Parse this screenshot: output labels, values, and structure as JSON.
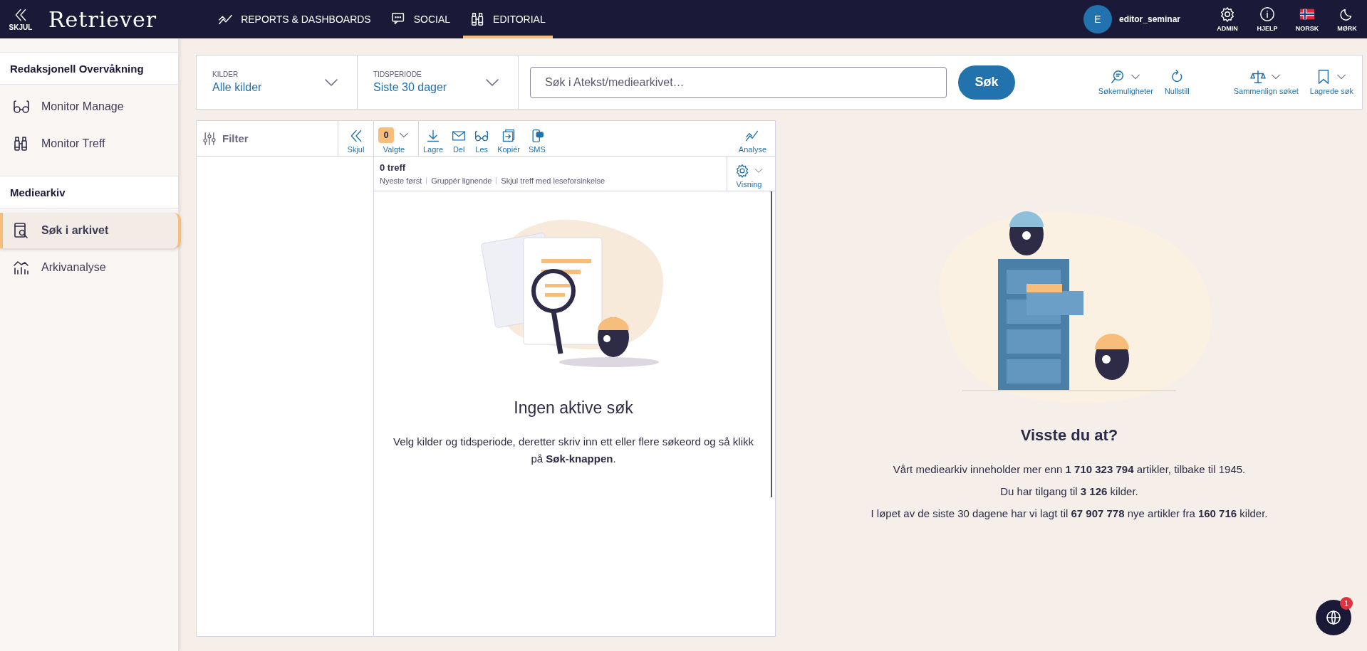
{
  "topbar": {
    "collapse": "SKJUL",
    "logo": "Retriever",
    "nav": [
      {
        "label": "REPORTS & DASHBOARDS",
        "kind": "chart",
        "selected": false
      },
      {
        "label": "SOCIAL",
        "kind": "chat",
        "selected": false
      },
      {
        "label": "EDITORIAL",
        "kind": "binoculars",
        "selected": true
      }
    ],
    "user": {
      "initial": "E",
      "name": "editor_seminar"
    },
    "actions": [
      {
        "label": "ADMIN",
        "kind": "gear"
      },
      {
        "label": "HJELP",
        "kind": "info"
      },
      {
        "label": "NORSK",
        "kind": "flag"
      },
      {
        "label": "MØRK",
        "kind": "moon"
      }
    ]
  },
  "sidebar": {
    "sections": [
      {
        "title": "Redaksjonell Overvåkning",
        "items": [
          {
            "label": "Monitor Manage",
            "kind": "glasses",
            "selected": false
          },
          {
            "label": "Monitor Treff",
            "kind": "binoculars",
            "selected": false
          }
        ]
      },
      {
        "title": "Mediearkiv",
        "items": [
          {
            "label": "Søk i arkivet",
            "kind": "search-doc",
            "selected": true
          },
          {
            "label": "Arkivanalyse",
            "kind": "bars",
            "selected": false
          }
        ]
      }
    ]
  },
  "search": {
    "sources": {
      "label": "KILDER",
      "value": "Alle kilder"
    },
    "period": {
      "label": "TIDSPERIODE",
      "value": "Siste 30 dager"
    },
    "query": {
      "placeholder": "Søk i Atekst/mediearkivet…"
    },
    "submit": "Søk",
    "tools": [
      {
        "label": "Søkemuligheter",
        "kind": "search-chat",
        "dropdown": true
      },
      {
        "label": "Nullstill",
        "kind": "reset",
        "dropdown": false
      },
      {
        "label": "Sammenlign søket",
        "kind": "scale",
        "dropdown": true
      },
      {
        "label": "Lagrede søk",
        "kind": "bookmark",
        "dropdown": true
      }
    ]
  },
  "results": {
    "filter": "Filter",
    "hide": "Skjul",
    "selected_count": "0",
    "selected_label": "Valgte",
    "actions": [
      {
        "label": "Lagre",
        "kind": "download"
      },
      {
        "label": "Del",
        "kind": "mail"
      },
      {
        "label": "Les",
        "kind": "glasses"
      },
      {
        "label": "Kopiér",
        "kind": "copy"
      },
      {
        "label": "SMS",
        "kind": "phone"
      }
    ],
    "analyse": "Analyse",
    "count": "0 treff",
    "sort_options": [
      "Nyeste først",
      "Gruppér lignende",
      "Skjul treff med leseforsinkelse"
    ],
    "view": "Visning",
    "empty": {
      "title": "Ingen aktive søk",
      "text": "Velg kilder og tidsperiode, deretter skriv inn ett eller flere søkeord og så klikk på **Søk-knappen**."
    }
  },
  "info": {
    "title": "Visste du at?",
    "lines": [
      "Vårt mediearkiv inneholder mer enn **1 710 323 794** artikler, tilbake til 1945.",
      "Du har tilgang til **3 126** kilder.",
      "I løpet av de siste 30 dagene har vi lagt til **67 907 778** nye artikler fra **160 716** kilder."
    ]
  },
  "chat": {
    "badge": "1"
  }
}
